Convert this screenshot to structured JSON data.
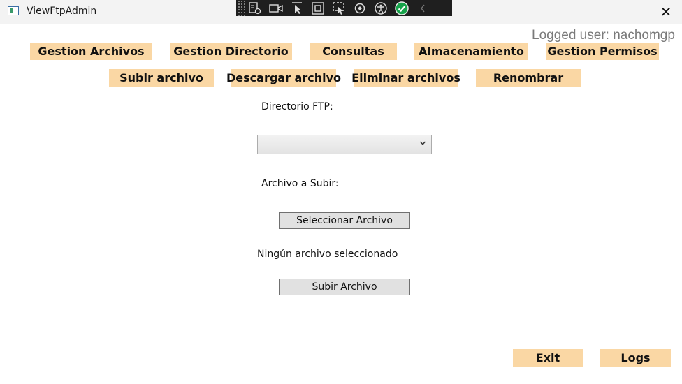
{
  "window": {
    "title": "ViewFtpAdmin",
    "close_glyph": "✕"
  },
  "debug_toolbar": {
    "icons": [
      "grip-icon",
      "live-visual-tree-icon",
      "record-icon",
      "select-element-icon",
      "display-layout-adorners-icon",
      "track-focus-icon",
      "hot-reload-icon",
      "accessibility-checker-icon",
      "check-icon",
      "collapse-chevron-icon"
    ]
  },
  "header": {
    "logged_user": "Logged user: nachomgp"
  },
  "nav": {
    "gestion_archivos": "Gestion Archivos",
    "gestion_directorio": "Gestion Directorio",
    "consultas": "Consultas",
    "almacenamiento": "Almacenamiento",
    "gestion_permisos": "Gestion Permisos"
  },
  "subnav": {
    "subir_archivo": "Subir archivo",
    "descargar_archivo": "Descargar archivo",
    "eliminar_archivos": "Eliminar archivos",
    "renombrar": "Renombrar"
  },
  "form": {
    "directorio_label": "Directorio FTP:",
    "directorio_value": "",
    "archivo_label": "Archivo a Subir:",
    "seleccionar_button": "Seleccionar Archivo",
    "status_text": "Ningún archivo seleccionado",
    "subir_button": "Subir Archivo"
  },
  "footer": {
    "exit_button": "Exit",
    "logs_button": "Logs"
  },
  "colors": {
    "accent_button": "#fad7a4",
    "system_button": "#e1e1e1",
    "logged_user_text": "#7a7a7a"
  }
}
